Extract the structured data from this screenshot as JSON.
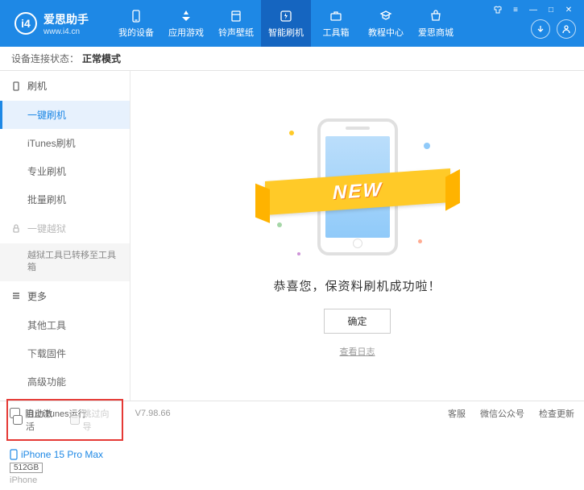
{
  "header": {
    "logo_title": "爱思助手",
    "logo_url": "www.i4.cn",
    "nav": [
      {
        "label": "我的设备"
      },
      {
        "label": "应用游戏"
      },
      {
        "label": "铃声壁纸"
      },
      {
        "label": "智能刷机"
      },
      {
        "label": "工具箱"
      },
      {
        "label": "教程中心"
      },
      {
        "label": "爱思商城"
      }
    ]
  },
  "status": {
    "label": "设备连接状态：",
    "value": "正常模式"
  },
  "sidebar": {
    "section_flash": "刷机",
    "items_flash": [
      "一键刷机",
      "iTunes刷机",
      "专业刷机",
      "批量刷机"
    ],
    "section_jailbreak": "一键越狱",
    "jailbreak_note": "越狱工具已转移至工具箱",
    "section_more": "更多",
    "items_more": [
      "其他工具",
      "下载固件",
      "高级功能"
    ],
    "chk_auto_activate": "自动激活",
    "chk_skip_guide": "跳过向导"
  },
  "device": {
    "name": "iPhone 15 Pro Max",
    "storage": "512GB",
    "type": "iPhone"
  },
  "main": {
    "ribbon": "NEW",
    "success": "恭喜您，保资料刷机成功啦！",
    "ok": "确定",
    "view_log": "查看日志"
  },
  "footer": {
    "block_itunes": "阻止iTunes运行",
    "version": "V7.98.66",
    "support": "客服",
    "wechat": "微信公众号",
    "check_update": "检查更新"
  }
}
